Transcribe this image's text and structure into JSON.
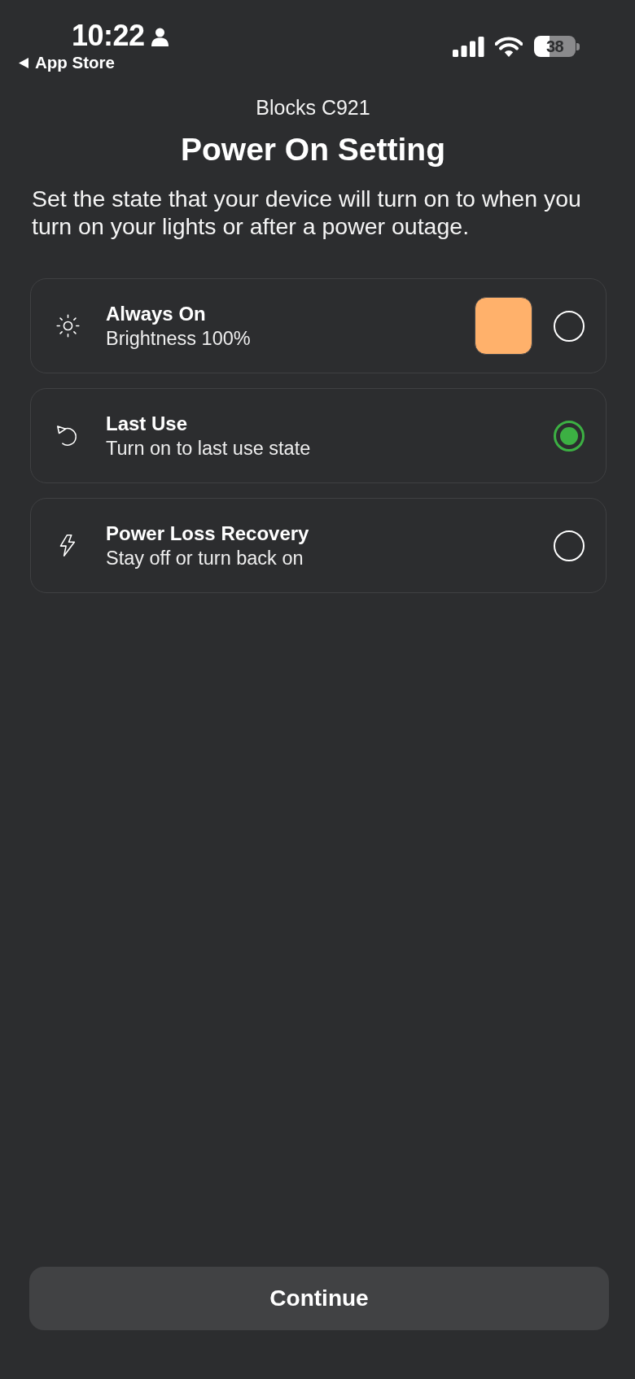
{
  "status_bar": {
    "time": "10:22",
    "back_link": "App Store",
    "battery": "38"
  },
  "header": {
    "device": "Blocks C921",
    "title": "Power On Setting",
    "description": "Set the state that your device will turn on to when you turn on your lights or after a power outage."
  },
  "options": [
    {
      "kind": "brightness",
      "title": "Always On",
      "subtitle": "Brightness 100%",
      "color": "#ffb16b",
      "selected": false
    },
    {
      "kind": "last-use",
      "title": "Last Use",
      "subtitle": "Turn on to last use state",
      "selected": true
    },
    {
      "kind": "power-loss",
      "title": "Power Loss Recovery",
      "subtitle": "Stay off or turn back on",
      "selected": false
    }
  ],
  "continue_button": {
    "label": "Continue"
  }
}
